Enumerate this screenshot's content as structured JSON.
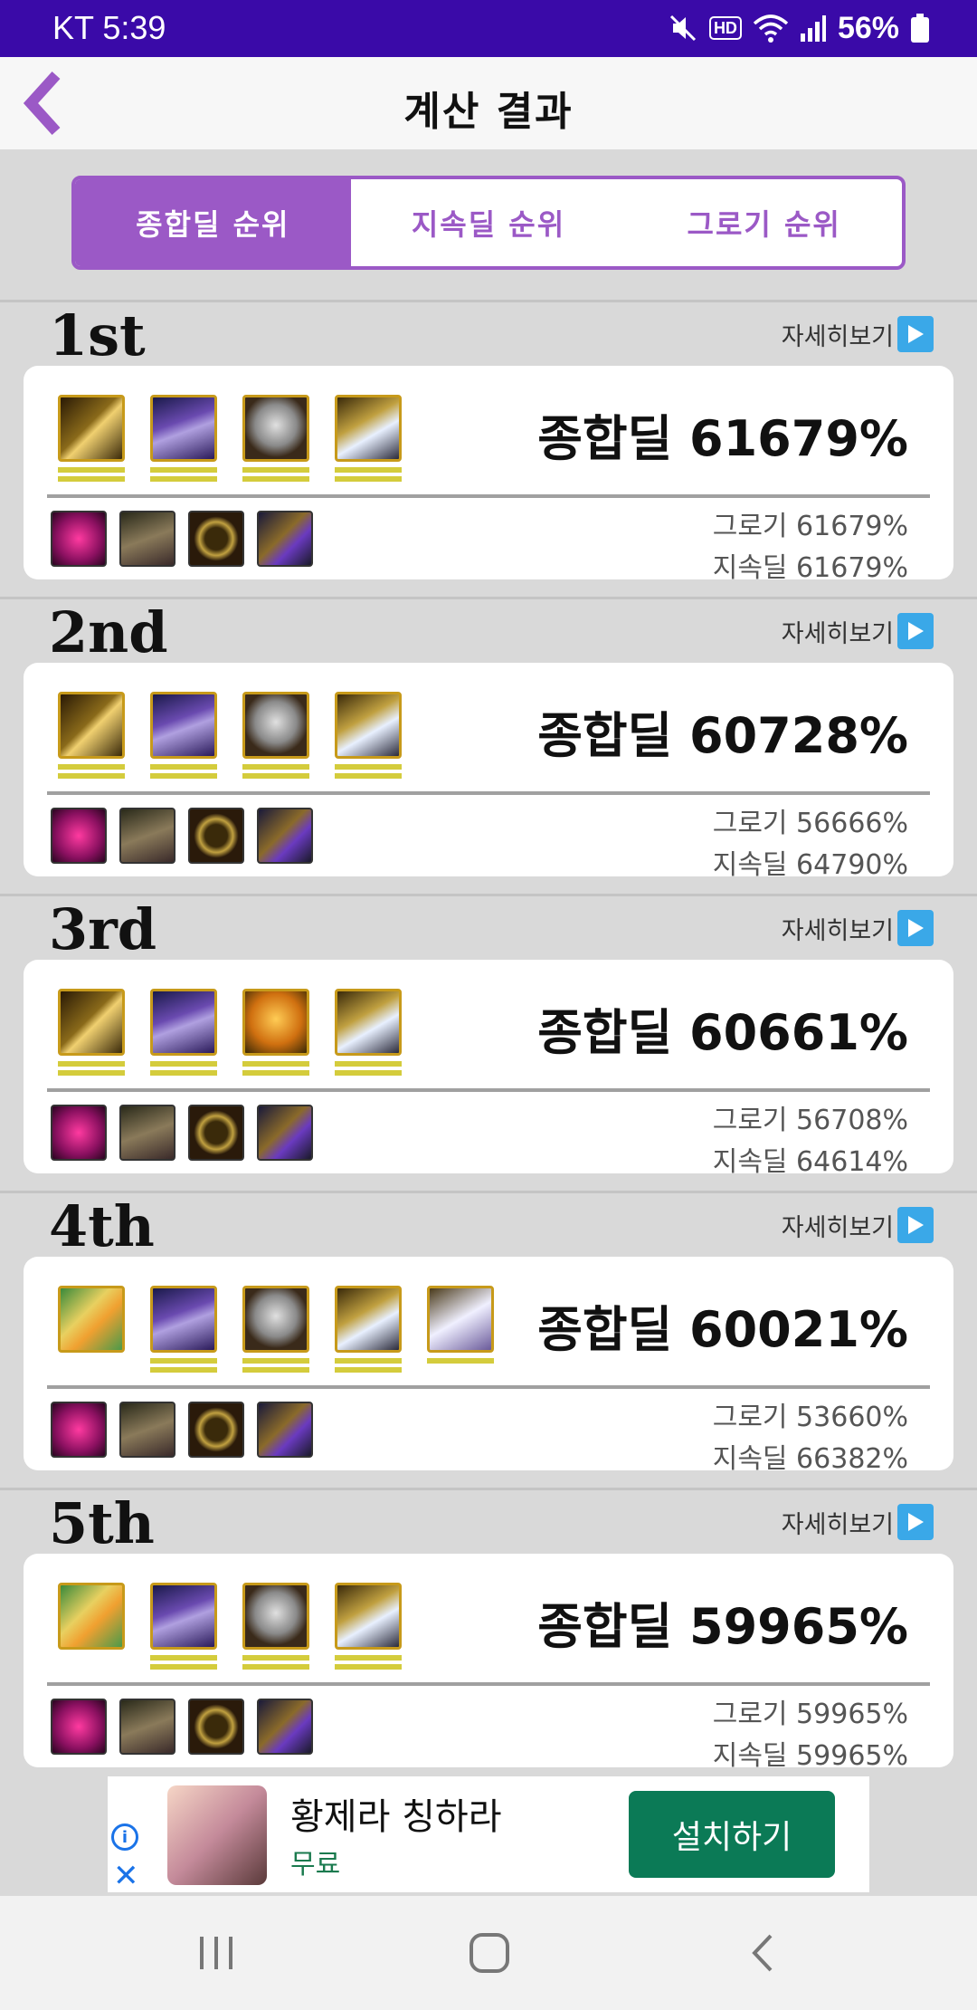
{
  "status": {
    "carrier_time": "KT 5:39",
    "battery": "56%",
    "hd_label": "HD"
  },
  "header": {
    "title": "계산 결과"
  },
  "tabs": [
    {
      "label": "종합딜 순위",
      "active": true
    },
    {
      "label": "지속딜 순위",
      "active": false
    },
    {
      "label": "그로기 순위",
      "active": false
    }
  ],
  "results": [
    {
      "rank": "1st",
      "detail": "자세히보기",
      "total": "종합딜 61679%",
      "groggy": "그로기 61679%",
      "sustain": "지속딜 61679%"
    },
    {
      "rank": "2nd",
      "detail": "자세히보기",
      "total": "종합딜 60728%",
      "groggy": "그로기 56666%",
      "sustain": "지속딜 64790%"
    },
    {
      "rank": "3rd",
      "detail": "자세히보기",
      "total": "종합딜 60661%",
      "groggy": "그로기 56708%",
      "sustain": "지속딜 64614%"
    },
    {
      "rank": "4th",
      "detail": "자세히보기",
      "total": "종합딜 60021%",
      "groggy": "그로기 53660%",
      "sustain": "지속딜 66382%"
    },
    {
      "rank": "5th",
      "detail": "자세히보기",
      "total": "종합딜 59965%",
      "groggy": "그로기 59965%",
      "sustain": "지속딜 59965%"
    }
  ],
  "ad": {
    "title": "황제라 칭하라",
    "subtitle": "무료",
    "button": "설치하기"
  },
  "colors": {
    "status_bar": "#3a0aa8",
    "accent": "#9b59c6",
    "install_button": "#0b7a56"
  }
}
